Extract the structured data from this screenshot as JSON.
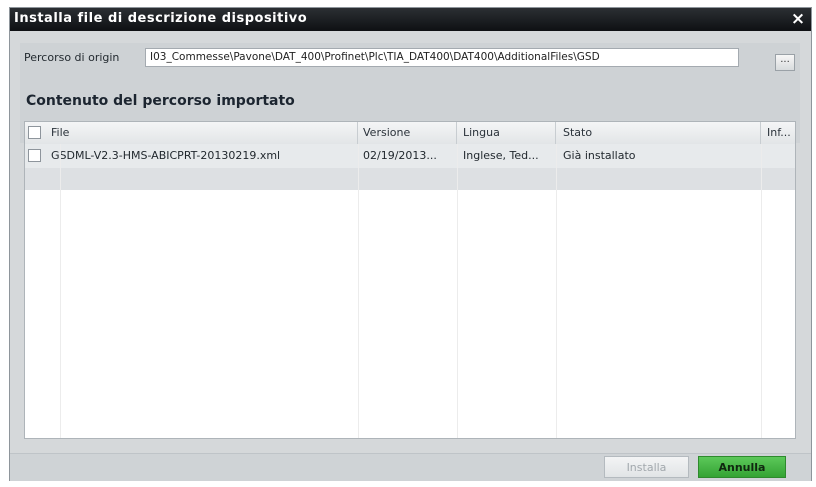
{
  "dialog": {
    "title": "Installa file di descrizione dispositivo",
    "close_icon": "×"
  },
  "source": {
    "label": "Percorso di origin",
    "value": "I03_Commesse\\Pavone\\DAT_400\\Profinet\\Plc\\TIA_DAT400\\DAT400\\AdditionalFiles\\GSD",
    "browse_label": "..."
  },
  "content": {
    "title": "Contenuto del percorso importato",
    "columns": [
      "File",
      "Versione",
      "Lingua",
      "Stato",
      "Inf..."
    ],
    "rows": [
      {
        "file": "GSDML-V2.3-HMS-ABICPRT-20130219.xml",
        "version": "02/19/2013...",
        "language": "Inglese, Ted...",
        "status": "Già installato",
        "info": ""
      }
    ]
  },
  "buttons": {
    "install": "Installa",
    "cancel": "Annulla"
  }
}
